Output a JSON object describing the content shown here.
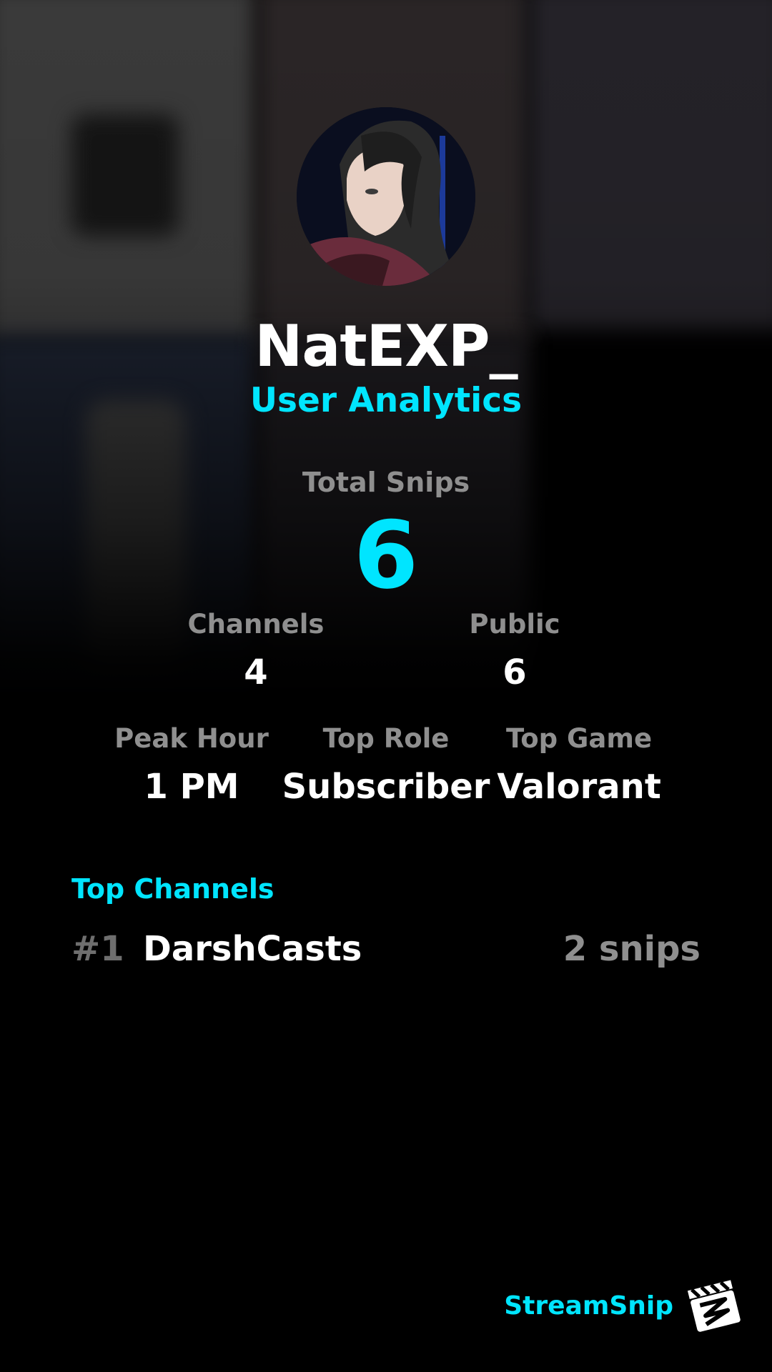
{
  "profile": {
    "username": "NatEXP_",
    "subtitle": "User Analytics"
  },
  "stats": {
    "total_label": "Total Snips",
    "total_value": "6",
    "channels_label": "Channels",
    "channels_value": "4",
    "public_label": "Public",
    "public_value": "6",
    "peak_hour_label": "Peak Hour",
    "peak_hour_value": "1 PM",
    "top_role_label": "Top Role",
    "top_role_value": "Subscriber",
    "top_game_label": "Top Game",
    "top_game_value": "Valorant"
  },
  "top_channels": {
    "title": "Top Channels",
    "items": [
      {
        "rank": "#1",
        "name": "DarshCasts",
        "count": "2 snips"
      }
    ]
  },
  "brand": {
    "name": "StreamSnip",
    "logo_icon": "clapperboard-icon"
  },
  "colors": {
    "accent": "#00e5ff",
    "muted": "#8f8f8f",
    "background": "#000000"
  }
}
